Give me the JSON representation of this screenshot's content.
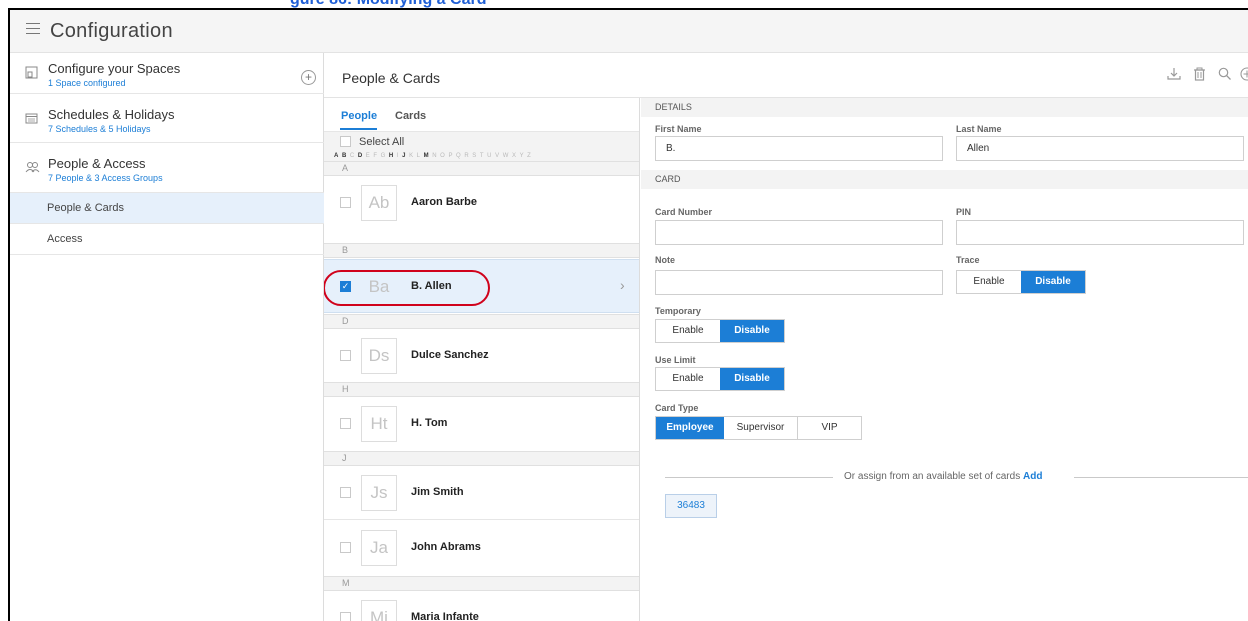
{
  "banner": {
    "text": "gure 86: Modifying a Card"
  },
  "app": {
    "title": "Configuration"
  },
  "sidebar": {
    "items": [
      {
        "title": "Configure your Spaces",
        "subtitle": "1 Space configured",
        "icon": "space-icon"
      },
      {
        "title": "Schedules & Holidays",
        "subtitle": "7 Schedules & 5 Holidays",
        "icon": "calendar-icon"
      },
      {
        "title": "People & Access",
        "subtitle": "7 People & 3 Access Groups",
        "icon": "people-icon"
      }
    ],
    "sub_items": [
      {
        "label": "People & Cards",
        "active": true
      },
      {
        "label": "Access",
        "active": false
      }
    ]
  },
  "content": {
    "title": "People & Cards",
    "tools": [
      "download-icon",
      "delete-icon",
      "search-icon",
      "add-icon"
    ]
  },
  "people_list": {
    "tabs": [
      "People",
      "Cards"
    ],
    "active_tab": "People",
    "select_all": "Select All",
    "alphabet": [
      "A",
      "B",
      "C",
      "D",
      "E",
      "F",
      "G",
      "H",
      "I",
      "J",
      "K",
      "L",
      "M",
      "N",
      "O",
      "P",
      "Q",
      "R",
      "S",
      "T",
      "U",
      "V",
      "W",
      "X",
      "Y",
      "Z"
    ],
    "alphabet_active": [
      "A",
      "B",
      "D",
      "H",
      "J",
      "M"
    ],
    "sections": [
      {
        "letter": "A",
        "people": [
          {
            "initials": "Ab",
            "name": "Aaron Barbe",
            "checked": false
          }
        ]
      },
      {
        "letter": "B",
        "people": [
          {
            "initials": "Ba",
            "name": "B. Allen",
            "checked": true,
            "selected": true
          }
        ]
      },
      {
        "letter": "D",
        "people": [
          {
            "initials": "Ds",
            "name": "Dulce Sanchez",
            "checked": false
          }
        ]
      },
      {
        "letter": "H",
        "people": [
          {
            "initials": "Ht",
            "name": "H. Tom",
            "checked": false
          }
        ]
      },
      {
        "letter": "J",
        "people": [
          {
            "initials": "Js",
            "name": "Jim Smith",
            "checked": false
          },
          {
            "initials": "Ja",
            "name": "John Abrams",
            "checked": false
          }
        ]
      },
      {
        "letter": "M",
        "people": [
          {
            "initials": "Mi",
            "name": "Maria Infante",
            "checked": false
          }
        ]
      }
    ]
  },
  "details": {
    "details_header": "DETAILS",
    "first_name_label": "First Name",
    "first_name": "B.",
    "last_name_label": "Last Name",
    "last_name": "Allen",
    "card_header": "CARD",
    "card_number_label": "Card Number",
    "card_number": "",
    "pin_label": "PIN",
    "pin": "",
    "note_label": "Note",
    "note": "",
    "trace_label": "Trace",
    "trace_options": [
      "Enable",
      "Disable"
    ],
    "trace_selected": "Disable",
    "temporary_label": "Temporary",
    "temporary_options": [
      "Enable",
      "Disable"
    ],
    "temporary_selected": "Disable",
    "use_limit_label": "Use Limit",
    "use_limit_options": [
      "Enable",
      "Disable"
    ],
    "use_limit_selected": "Disable",
    "card_type_label": "Card Type",
    "card_type_options": [
      "Employee",
      "Supervisor",
      "VIP"
    ],
    "card_type_selected": "Employee",
    "assign_text": "Or assign from an available set of cards",
    "assign_link": "Add",
    "available_cards": [
      "36483"
    ]
  },
  "colors": {
    "accent": "#1c7ed6",
    "highlight": "#d0021b",
    "selected_row": "#e6f0fb"
  }
}
